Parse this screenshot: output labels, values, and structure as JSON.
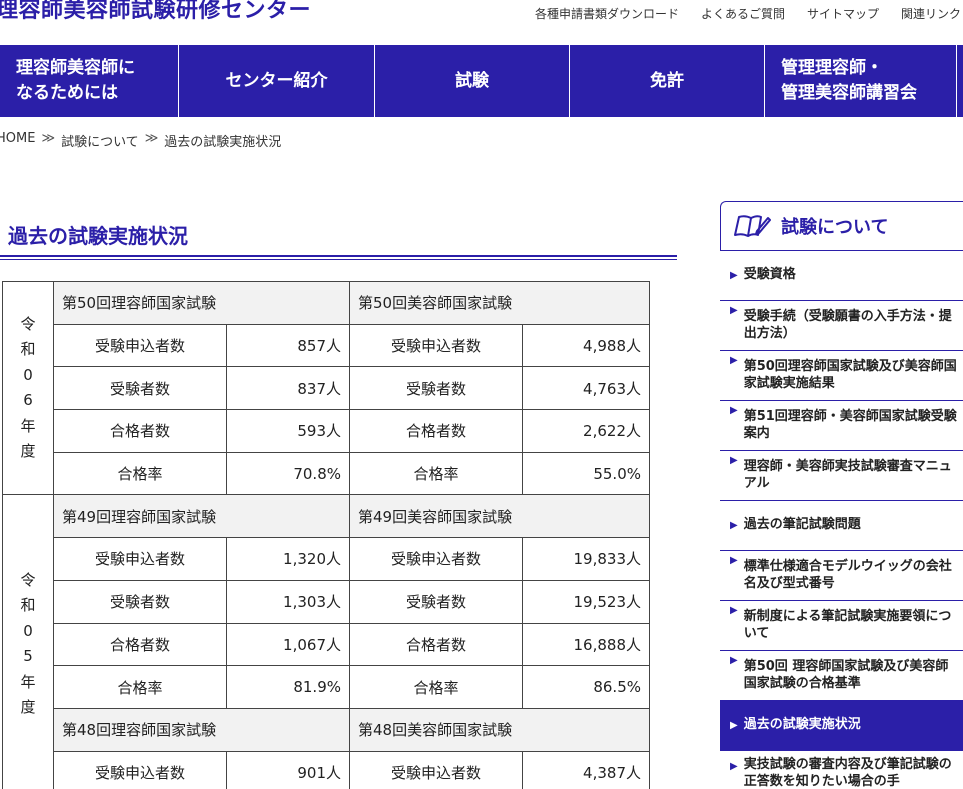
{
  "header": {
    "site_title": "理容師美容師試験研修センター",
    "util_links": [
      "各種申請書類ダウンロード",
      "よくあるご質問",
      "サイトマップ",
      "関連リンク"
    ]
  },
  "gnav": [
    {
      "label": "理容師美容師に\nなるためには"
    },
    {
      "label": "センター紹介"
    },
    {
      "label": "試験"
    },
    {
      "label": "免許"
    },
    {
      "label": "管理理容師・\n管理美容師講習会"
    }
  ],
  "breadcrumb": {
    "home": "HOME",
    "sep": "≫",
    "level1": "試験について",
    "current": "過去の試験実施状況"
  },
  "page_title": "過去の試験実施状況",
  "table": {
    "row_labels": {
      "applicants": "受験申込者数",
      "examinees": "受験者数",
      "passers": "合格者数",
      "rate": "合格率"
    },
    "years": [
      {
        "year_label": "令和06年度",
        "exams": [
          {
            "rihyo": "第50回理容師国家試験",
            "biyo": "第50回美容師国家試験",
            "rihyo_vals": [
              "857人",
              "837人",
              "593人",
              "70.8%"
            ],
            "biyo_vals": [
              "4,988人",
              "4,763人",
              "2,622人",
              "55.0%"
            ]
          }
        ]
      },
      {
        "year_label": "令和05年度",
        "exams": [
          {
            "rihyo": "第49回理容師国家試験",
            "biyo": "第49回美容師国家試験",
            "rihyo_vals": [
              "1,320人",
              "1,303人",
              "1,067人",
              "81.9%"
            ],
            "biyo_vals": [
              "19,833人",
              "19,523人",
              "16,888人",
              "86.5%"
            ]
          },
          {
            "rihyo": "第48回理容師国家試験",
            "biyo": "第48回美容師国家試験",
            "rihyo_vals": [
              "901人"
            ],
            "biyo_vals": [
              "4,387人"
            ]
          }
        ]
      }
    ]
  },
  "sidebar": {
    "title": "試験について",
    "icon": "open-book-pen-icon",
    "items": [
      {
        "label": "受験資格"
      },
      {
        "label": "受験手続（受験願書の入手方法・提出方法）"
      },
      {
        "label": "第50回理容師国家試験及び美容師国家試験実施結果"
      },
      {
        "label": "第51回理容師・美容師国家試験受験案内"
      },
      {
        "label": "理容師・美容師実技試験審査マニュアル"
      },
      {
        "label": "過去の筆記試験問題"
      },
      {
        "label": "標準仕様適合モデルウイッグの会社名及び型式番号"
      },
      {
        "label": "新制度による筆記試験実施要領について"
      },
      {
        "label": "第50回 理容師国家試験及び美容師国家試験の合格基準"
      },
      {
        "label": "過去の試験実施状況",
        "active": true
      },
      {
        "label": "実技試験の審査内容及び筆記試験の正答数を知りたい場合の手"
      }
    ]
  },
  "colors": {
    "brand": "#2b1fa8",
    "header_cell": "#f2f2f2"
  }
}
